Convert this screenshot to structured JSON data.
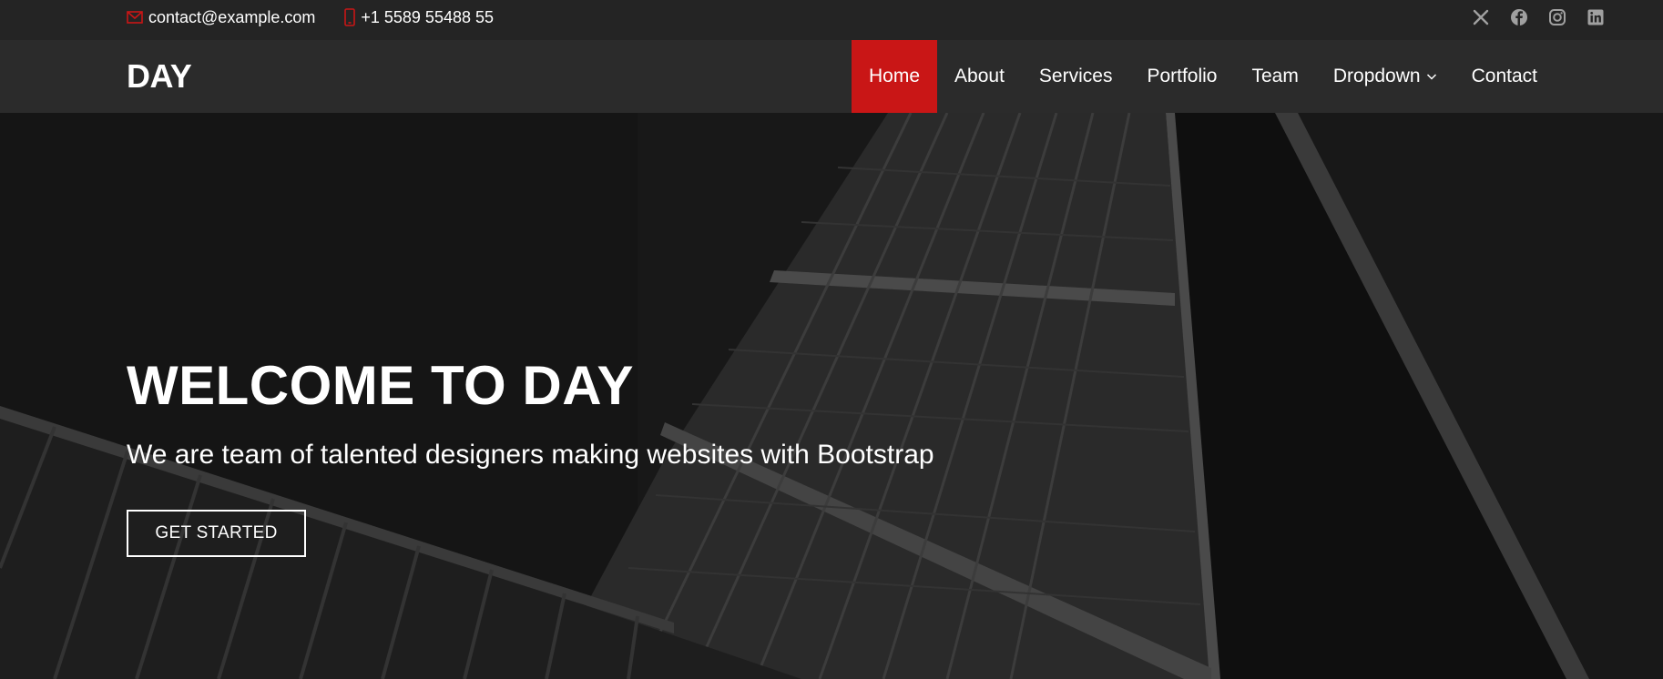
{
  "topbar": {
    "email": "contact@example.com",
    "phone": "+1 5589 55488 55",
    "social": [
      {
        "icon": "x-twitter-icon"
      },
      {
        "icon": "facebook-icon"
      },
      {
        "icon": "instagram-icon"
      },
      {
        "icon": "linkedin-icon"
      }
    ]
  },
  "header": {
    "logo": "DAY",
    "nav": [
      {
        "label": "Home",
        "active": true
      },
      {
        "label": "About"
      },
      {
        "label": "Services"
      },
      {
        "label": "Portfolio"
      },
      {
        "label": "Team"
      },
      {
        "label": "Dropdown",
        "has_dropdown": true
      },
      {
        "label": "Contact"
      }
    ]
  },
  "hero": {
    "title": "WELCOME TO DAY",
    "subtitle": "We are team of talented designers making websites with Bootstrap",
    "cta_label": "GET STARTED"
  },
  "colors": {
    "accent": "#c91616",
    "topbar_bg": "#242424",
    "header_bg": "#2b2b2b",
    "hero_bg": "#181818"
  }
}
